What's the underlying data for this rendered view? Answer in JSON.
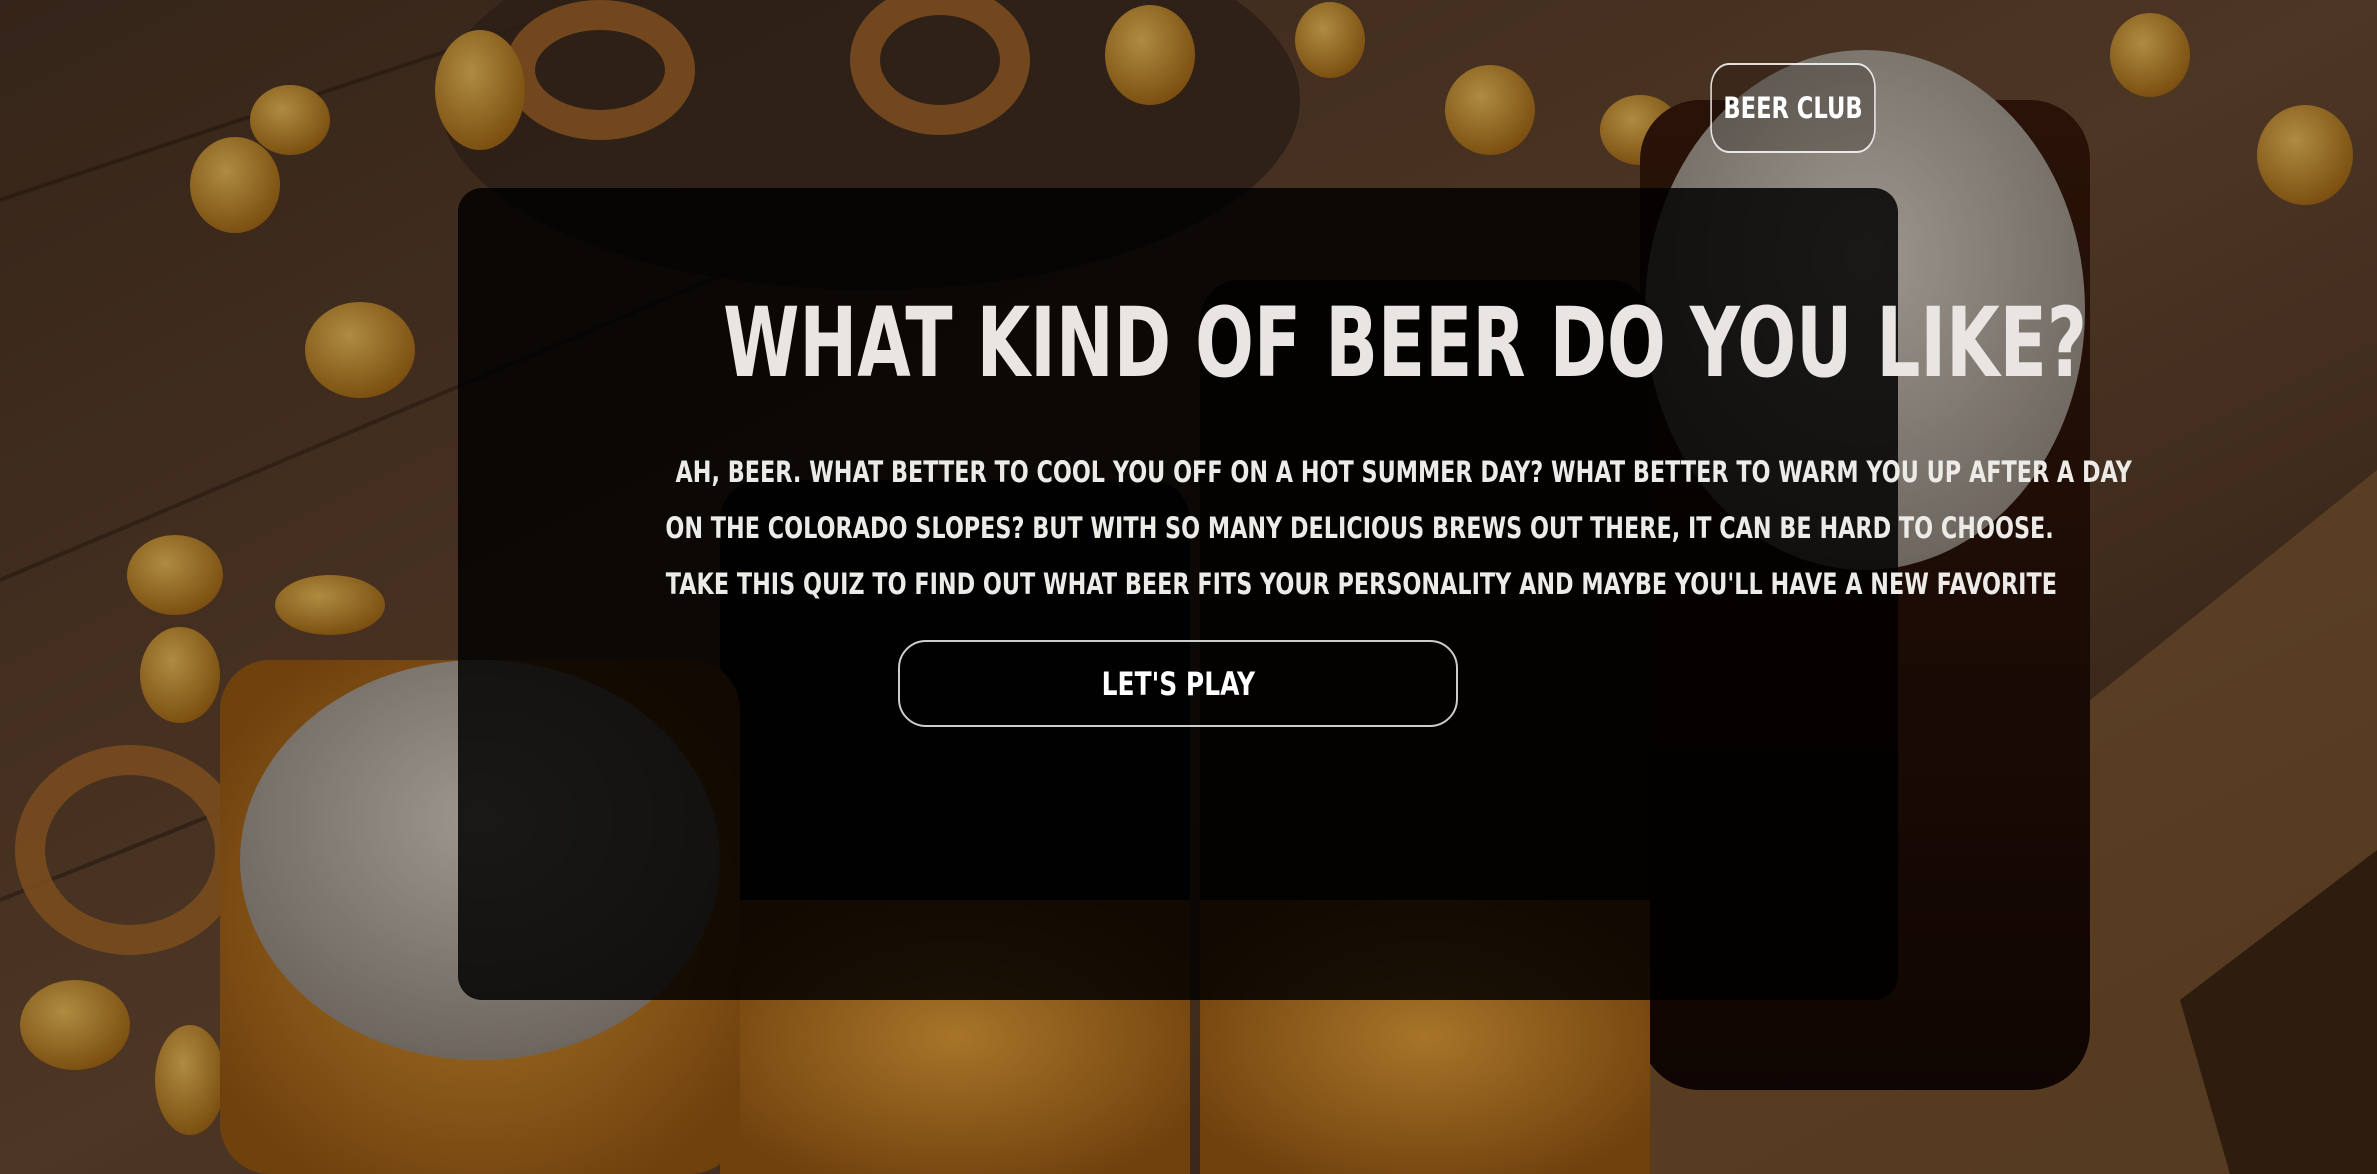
{
  "header": {
    "beer_club_label": "BEER CLUB"
  },
  "quiz": {
    "title": "WHAT KIND OF BEER DO YOU LIKE?",
    "intro_lines": [
      "AH, BEER. WHAT BETTER TO COOL YOU OFF ON A HOT SUMMER DAY? WHAT BETTER TO WARM YOU UP AFTER A DAY",
      "ON THE COLORADO SLOPES? BUT WITH SO MANY DELICIOUS BREWS OUT THERE, IT CAN BE HARD TO CHOOSE.",
      "TAKE THIS QUIZ TO FIND OUT WHAT BEER FITS YOUR PERSONALITY AND MAYBE YOU'LL HAVE A NEW FAVORITE"
    ],
    "play_label": "LET'S PLAY"
  },
  "colors": {
    "card_background": "#000000",
    "text": "#ffffff",
    "wood": "#5a3f2a",
    "beer_amber": "#d08a1c",
    "beer_dark": "#2a1208"
  }
}
